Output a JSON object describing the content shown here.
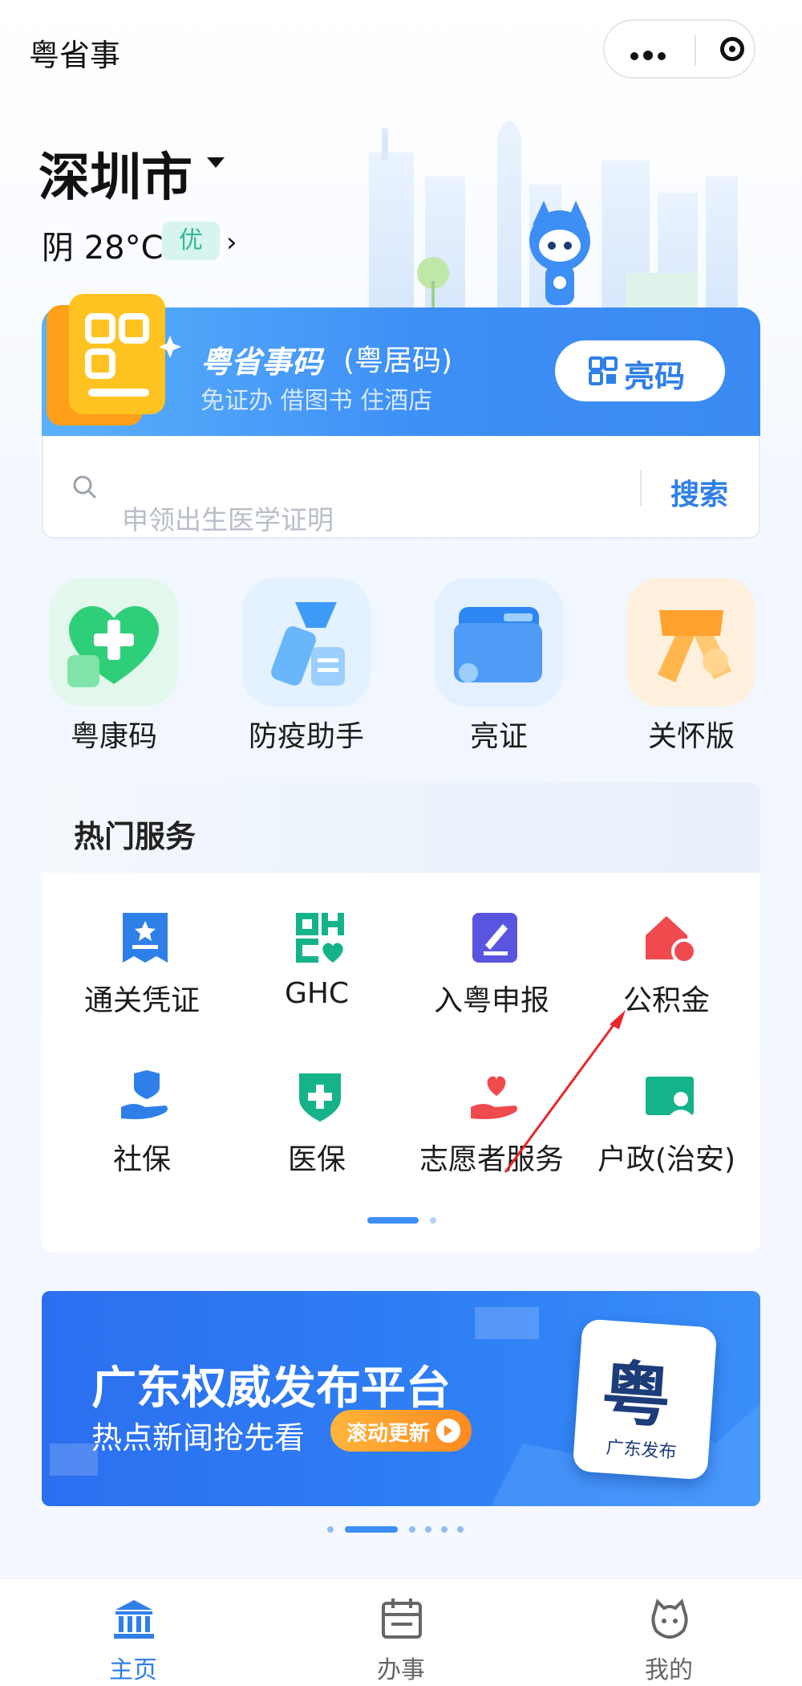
{
  "app": {
    "title": "粤省事"
  },
  "location": {
    "city": "深圳市",
    "weather": "阴 28°C",
    "air_quality": "优"
  },
  "code_card": {
    "title": "粤省事码",
    "subtitle": "(粤居码)",
    "description": "免证办 借图书 住酒店",
    "button_label": "亮码"
  },
  "search": {
    "placeholder": "申领出生医学证明",
    "button_label": "搜索"
  },
  "quick_access": [
    {
      "label": "粤康码",
      "icon": "health-heart-icon",
      "color": "#2fcf7a"
    },
    {
      "label": "防疫助手",
      "icon": "flashlight-icon",
      "color": "#3d9bf7"
    },
    {
      "label": "亮证",
      "icon": "wallet-card-icon",
      "color": "#2d86f2"
    },
    {
      "label": "关怀版",
      "icon": "scarf-icon",
      "color": "#ffa12c"
    }
  ],
  "hot_services": {
    "title": "热门服务",
    "items": [
      {
        "label": "通关凭证",
        "icon": "certificate-icon",
        "color": "#2f7fe8"
      },
      {
        "label": "GHC",
        "icon": "ghc-logo-icon",
        "color": "#15b38a"
      },
      {
        "label": "入粤申报",
        "icon": "edit-report-icon",
        "color": "#5a55e0"
      },
      {
        "label": "公积金",
        "icon": "house-fund-icon",
        "color": "#ef4b4f"
      },
      {
        "label": "社保",
        "icon": "social-security-icon",
        "color": "#2f7fe8"
      },
      {
        "label": "医保",
        "icon": "medical-shield-icon",
        "color": "#15b38a"
      },
      {
        "label": "志愿者服务",
        "icon": "volunteer-heart-icon",
        "color": "#ef4b4f"
      },
      {
        "label": "户政(治安)",
        "icon": "household-id-icon",
        "color": "#15b38a"
      }
    ]
  },
  "banner": {
    "title": "广东权威发布平台",
    "subtitle": "热点新闻抢先看",
    "tag": "滚动更新",
    "card_glyph": "粤",
    "card_caption": "广东发布"
  },
  "tabs": [
    {
      "label": "主页",
      "icon": "home-icon",
      "active": true
    },
    {
      "label": "办事",
      "icon": "calendar-icon",
      "active": false
    },
    {
      "label": "我的",
      "icon": "profile-icon",
      "active": false
    }
  ],
  "colors": {
    "accent": "#2f7fe8",
    "inactive_tab": "#666666"
  }
}
